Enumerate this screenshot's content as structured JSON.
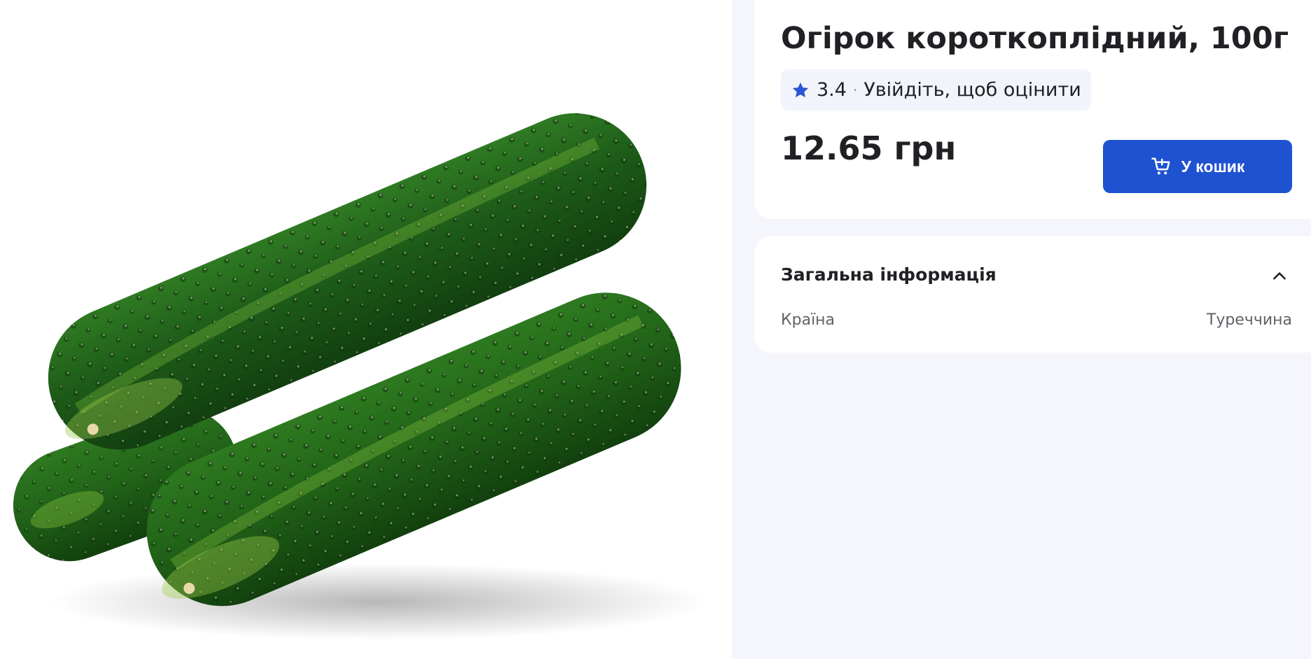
{
  "product": {
    "title": "Огірок короткоплідний, 100г",
    "rating": "3.4",
    "rating_separator": "·",
    "rating_prompt": "Увійдіть, щоб оцінити",
    "price": "12.65 грн",
    "image_icon": "cucumber-image"
  },
  "actions": {
    "add_to_cart_label": "У кошик",
    "cart_icon": "cart-add-icon"
  },
  "general_info": {
    "title": "Загальна інформація",
    "toggle_icon": "chevron-up-icon",
    "rows": [
      {
        "label": "Країна",
        "value": "Туреччина"
      }
    ]
  },
  "colors": {
    "accent": "#1f52d1",
    "star": "#2a56d4",
    "page_bg": "#f5f6fb",
    "card_bg": "#ffffff",
    "cucumber_dark": "#1f5a1b",
    "cucumber_light": "#6fae35"
  }
}
